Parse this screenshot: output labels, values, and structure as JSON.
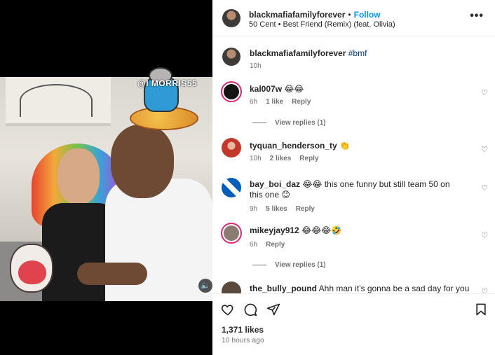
{
  "media": {
    "watermark": "@l MORRIS55"
  },
  "header": {
    "username": "blackmafiafamilyforever",
    "separator": "•",
    "follow_label": "Follow",
    "song": "50 Cent • Best Friend (Remix) (feat. Olivia)",
    "more_label": "•••"
  },
  "caption": {
    "username": "blackmafiafamilyforever",
    "hashtag": "#bmf",
    "time": "10h"
  },
  "comments": [
    {
      "username": "kal007w",
      "text": "😂😂",
      "time": "6h",
      "likes": "1 like",
      "reply": "Reply",
      "replies": "View replies (1)"
    },
    {
      "username": "tyquan_henderson_ty",
      "text": "👏",
      "time": "10h",
      "likes": "2 likes",
      "reply": "Reply"
    },
    {
      "username": "bay_boi_daz",
      "text": "😂😂 this one funny but still team 50 on this one 😊",
      "time": "9h",
      "likes": "5 likes",
      "reply": "Reply"
    },
    {
      "username": "mikeyjay912",
      "text": "😂😂😂🤣",
      "time": "6h",
      "reply": "Reply",
      "replies": "View replies (1)"
    },
    {
      "username": "the_bully_pound",
      "text": "Ahh man it’s gonna be a sad day for you"
    }
  ],
  "footer": {
    "likes": "1,371 likes",
    "time": "10 hours ago"
  },
  "colors": {
    "accent": "#0095f6",
    "story_ring": "#d62976",
    "muted_text": "#737373"
  }
}
